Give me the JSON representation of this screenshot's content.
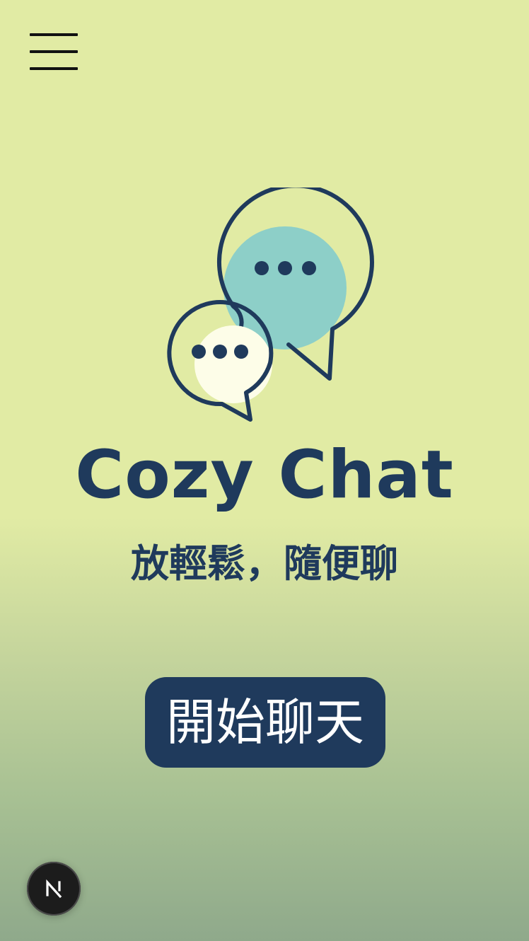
{
  "header": {
    "menu_icon": "hamburger-menu-icon"
  },
  "logo": {
    "icon": "chat-bubbles-icon",
    "colors": {
      "outline": "#1f3a5c",
      "large_bubble_fill": "#8dcfc8",
      "small_bubble_fill": "#fdfde8"
    }
  },
  "brand": {
    "title": "Cozy Chat",
    "tagline": "放輕鬆，隨便聊"
  },
  "actions": {
    "start_label": "開始聊天"
  },
  "dev_badge": {
    "icon": "nextjs-n-icon"
  },
  "colors": {
    "primary": "#1f3a5c",
    "background_top": "#e1eba4",
    "background_bottom": "#8fa98b",
    "button_text": "#ffffff"
  }
}
